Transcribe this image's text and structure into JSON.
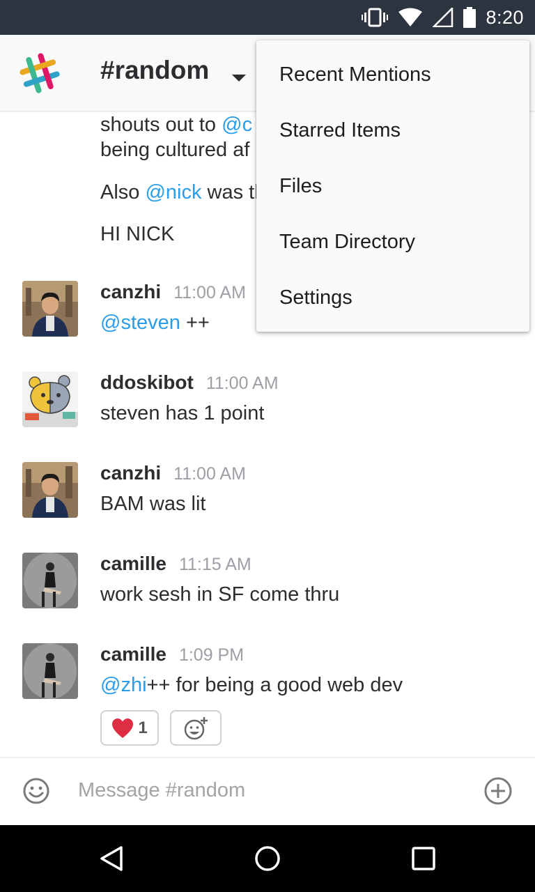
{
  "status_bar": {
    "time": "8:20",
    "icons": [
      "vibrate-icon",
      "wifi-icon",
      "cellular-icon",
      "battery-icon"
    ]
  },
  "header": {
    "channel_name": "#random",
    "icons": [
      "slack-logo",
      "dropdown-caret-icon"
    ]
  },
  "colors": {
    "mention": "#2a9ce8",
    "header_bg": "#f9f9f9",
    "status_bar": "#2c3440",
    "heart": "#dd2e44"
  },
  "messages": {
    "partial": {
      "line1_text": "shouts out to ",
      "line1_mention": "@c",
      "line2_text": "being cultured af",
      "line3_text_a": "Also ",
      "line3_mention": "@nick",
      "line3_text_b": " was tl",
      "line4_text": "HI NICK"
    },
    "items": [
      {
        "author": "canzhi",
        "time": "11:00 AM",
        "mention": "@steven",
        "text": " ++"
      },
      {
        "author": "ddoskibot",
        "time": "11:00 AM",
        "mention": "",
        "text": "steven has 1 point"
      },
      {
        "author": "canzhi",
        "time": "11:00 AM",
        "mention": "",
        "text": "BAM was lit"
      },
      {
        "author": "camille",
        "time": "11:15 AM",
        "mention": "",
        "text": "work sesh in SF come thru"
      },
      {
        "author": "camille",
        "time": "1:09 PM",
        "mention": "@zhi",
        "text": "++ for being a good web dev"
      }
    ],
    "reactions": [
      {
        "emoji": "heart-icon",
        "count": "1"
      },
      {
        "emoji": "add-reaction-icon",
        "count": ""
      }
    ]
  },
  "composer": {
    "placeholder": "Message #random",
    "icons": [
      "emoji-icon",
      "plus-circle-icon"
    ]
  },
  "menu": {
    "items": [
      "Recent Mentions",
      "Starred Items",
      "Files",
      "Team Directory",
      "Settings"
    ]
  },
  "navigation": {
    "icons": [
      "back-triangle-icon",
      "home-circle-icon",
      "recents-square-icon"
    ]
  }
}
